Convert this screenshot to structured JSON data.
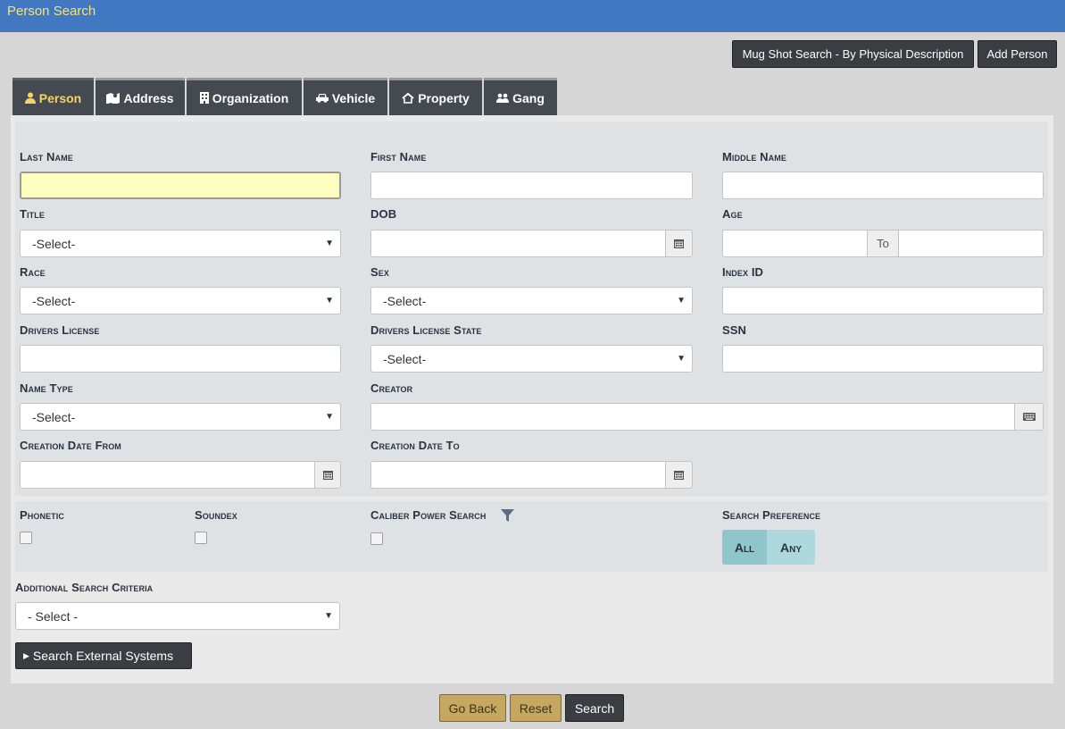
{
  "header": {
    "title": "Person Search"
  },
  "actions": {
    "mugshot_label": "Mug Shot Search - By Physical Description",
    "add_person_label": "Add Person"
  },
  "tabs": [
    {
      "label": "Person",
      "icon": "user-icon"
    },
    {
      "label": "Address",
      "icon": "map-icon"
    },
    {
      "label": "Organization",
      "icon": "building-icon"
    },
    {
      "label": "Vehicle",
      "icon": "car-icon"
    },
    {
      "label": "Property",
      "icon": "property-icon"
    },
    {
      "label": "Gang",
      "icon": "users-icon"
    }
  ],
  "fields": {
    "last_name": {
      "label": "Last Name",
      "value": ""
    },
    "first_name": {
      "label": "First Name",
      "value": ""
    },
    "middle_name": {
      "label": "Middle Name",
      "value": ""
    },
    "title": {
      "label": "Title",
      "selected": "-Select-"
    },
    "dob": {
      "label": "DOB",
      "value": ""
    },
    "age": {
      "label": "Age",
      "to_label": "To"
    },
    "race": {
      "label": "Race",
      "selected": "-Select-"
    },
    "sex": {
      "label": "Sex",
      "selected": "-Select-"
    },
    "index_id": {
      "label": "Index ID",
      "value": ""
    },
    "drivers_license": {
      "label": "Drivers License",
      "value": ""
    },
    "drivers_license_state": {
      "label": "Drivers License State",
      "selected": "-Select-"
    },
    "ssn": {
      "label": "SSN",
      "value": ""
    },
    "name_type": {
      "label": "Name Type",
      "selected": "-Select-"
    },
    "creator": {
      "label": "Creator",
      "value": ""
    },
    "creation_date_from": {
      "label": "Creation Date From",
      "value": ""
    },
    "creation_date_to": {
      "label": "Creation Date To",
      "value": ""
    }
  },
  "options": {
    "phonetic": {
      "label": "Phonetic",
      "checked": false
    },
    "soundex": {
      "label": "Soundex",
      "checked": false
    },
    "caliber": {
      "label": "Caliber Power Search",
      "checked": false
    },
    "search_preference": {
      "label": "Search Preference",
      "all": "All",
      "any": "Any"
    }
  },
  "additional": {
    "label": "Additional Search Criteria",
    "selected": "- Select -"
  },
  "external": {
    "label": "Search External Systems"
  },
  "footer": {
    "go_back": "Go Back",
    "reset": "Reset",
    "search": "Search"
  },
  "colors": {
    "header_bg": "#4278c2",
    "header_text": "#f3e37c",
    "tab_bg": "#454950",
    "active_tab_text": "#f3d36e",
    "gold_button": "#c5a760",
    "pref_all": "#8fc6cc",
    "pref_any": "#add8de"
  }
}
